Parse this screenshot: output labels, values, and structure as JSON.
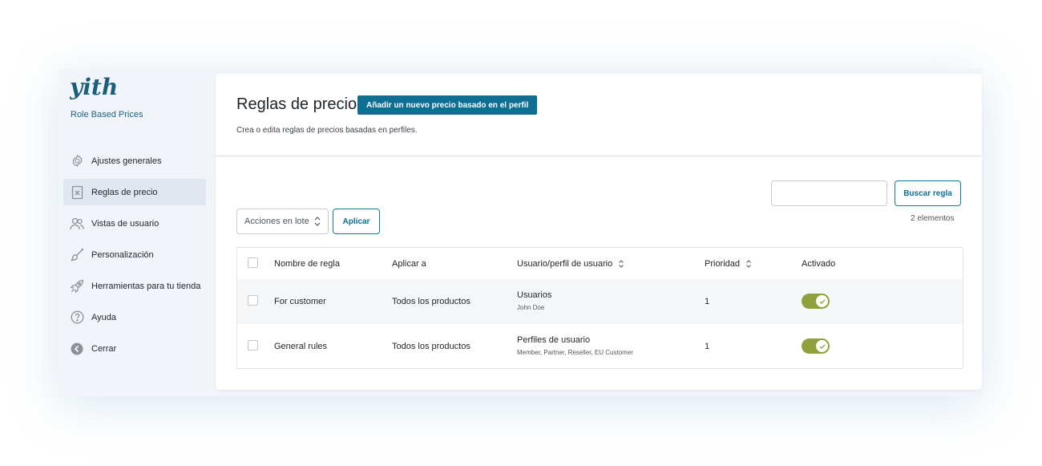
{
  "sidebar": {
    "logo_text": "yith",
    "plugin_name": "Role Based Prices",
    "items": [
      {
        "label": "Ajustes generales",
        "icon": "gear-icon"
      },
      {
        "label": "Reglas de precio",
        "icon": "price-tag-icon"
      },
      {
        "label": "Vistas de usuario",
        "icon": "users-icon"
      },
      {
        "label": "Personalización",
        "icon": "brush-icon"
      },
      {
        "label": "Herramientas para tu tienda",
        "icon": "rocket-icon"
      },
      {
        "label": "Ayuda",
        "icon": "help-icon"
      },
      {
        "label": "Cerrar",
        "icon": "close-arrow-icon"
      }
    ]
  },
  "header": {
    "title": "Reglas de precio",
    "add_button": "Añadir un nuevo precio basado en el perfil",
    "description": "Crea o edita reglas de precios basadas en perfiles."
  },
  "search": {
    "placeholder": "",
    "button": "Buscar regla"
  },
  "items_count": "2 elementos",
  "bulk": {
    "selected": "Acciones en lote",
    "apply": "Aplicar"
  },
  "table": {
    "columns": [
      "Nombre de regla",
      "Aplicar a",
      "Usuario/perfil de usuario",
      "Prioridad",
      "Activado"
    ],
    "rows": [
      {
        "name": "For customer",
        "apply_to": "Todos los productos",
        "user_type": "Usuarios",
        "user_detail": "John Doe",
        "priority": "1",
        "enabled": true
      },
      {
        "name": "General rules",
        "apply_to": "Todos los productos",
        "user_type": "Perfiles de usuario",
        "user_detail": "Member, Partner, Reseller, EU Customer",
        "priority": "1",
        "enabled": true
      }
    ]
  },
  "colors": {
    "primary": "#0e6e94",
    "toggle_on": "#8fa13b",
    "sidebar_bg": "#f1f4f8",
    "active_item_bg": "#e1e7ef"
  }
}
